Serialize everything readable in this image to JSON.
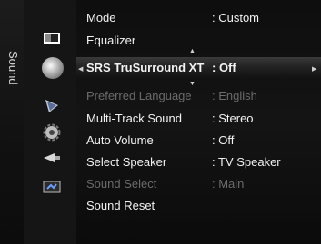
{
  "tab": {
    "label": "Sound"
  },
  "menu": {
    "items": [
      {
        "label": "Mode",
        "value": ": Custom"
      },
      {
        "label": "Equalizer",
        "value": ""
      },
      {
        "label": "SRS TruSurround XT",
        "value": ": Off"
      },
      {
        "label": "Preferred Language",
        "value": ": English"
      },
      {
        "label": "Multi-Track Sound",
        "value": ": Stereo"
      },
      {
        "label": "Auto Volume",
        "value": ": Off"
      },
      {
        "label": "Select Speaker",
        "value": ": TV Speaker"
      },
      {
        "label": "Sound Select",
        "value": ": Main"
      },
      {
        "label": "Sound Reset",
        "value": ""
      }
    ]
  },
  "icons": [
    "picture-icon",
    "sound-icon",
    "channel-icon",
    "setup-icon",
    "input-icon",
    "application-icon"
  ]
}
